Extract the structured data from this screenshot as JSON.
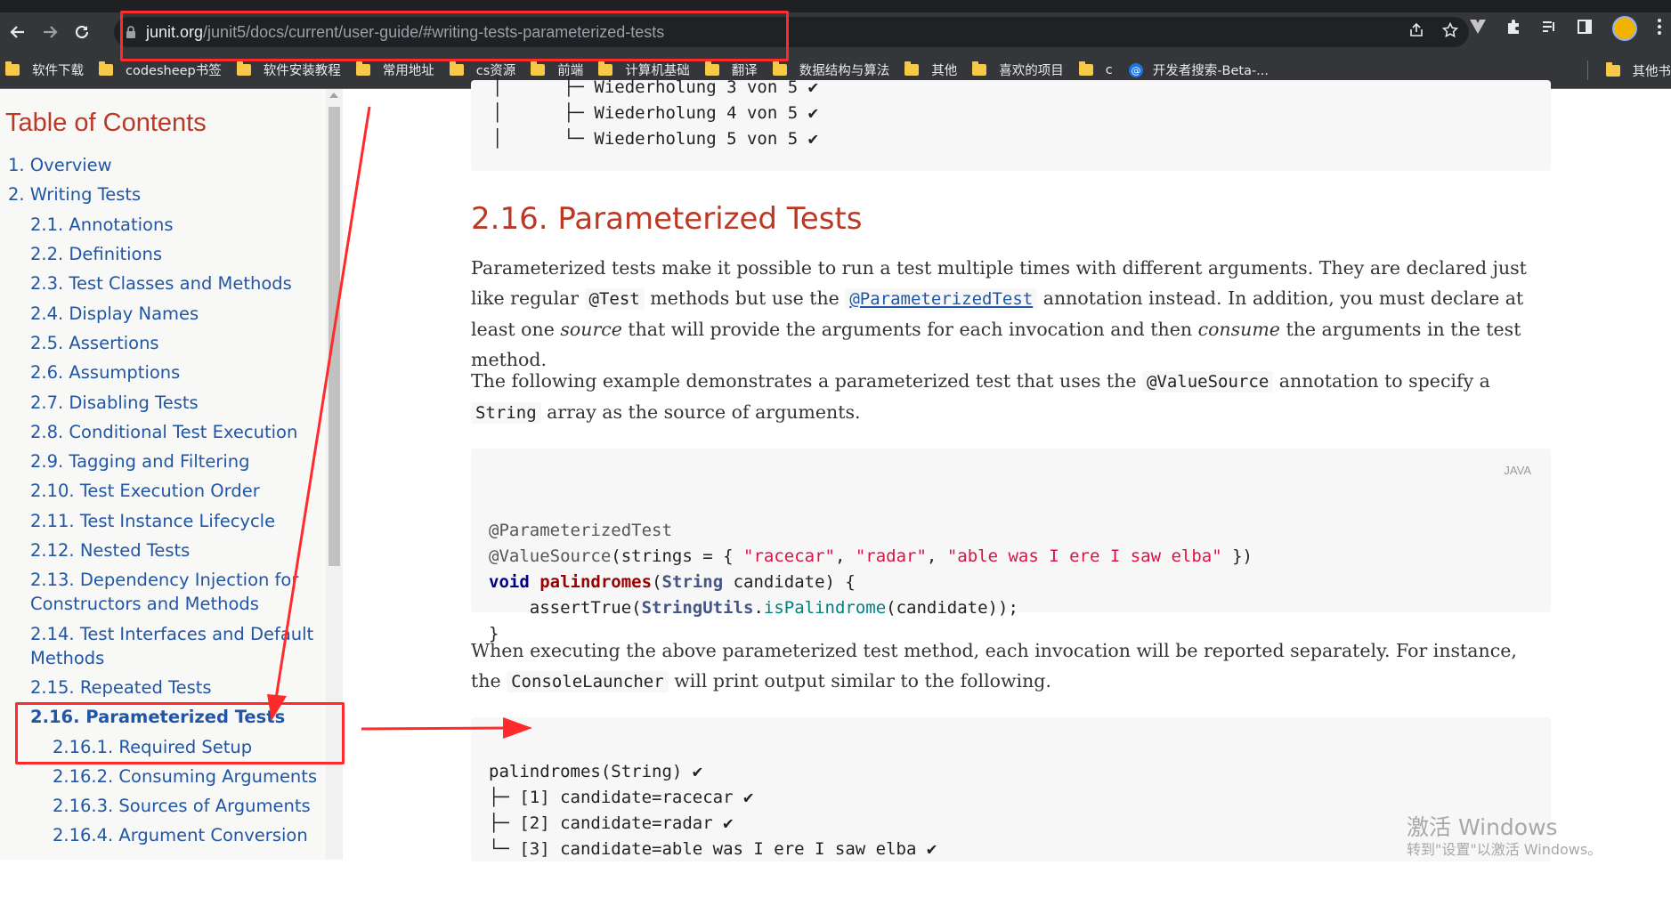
{
  "browser": {
    "url_domain": "junit.org",
    "url_path": "/junit5/docs/current/user-guide/#writing-tests-parameterized-tests",
    "bookmarks": [
      "软件下载",
      "codesheep书签",
      "软件安装教程",
      "常用地址",
      "cs资源",
      "前端",
      "计算机基础",
      "翻译",
      "数据结构与算法",
      "其他",
      "喜欢的项目",
      "c",
      "开发者搜索-Beta-..."
    ],
    "other_bookmarks": "其他书"
  },
  "toc": {
    "title": "Table of Contents",
    "items": [
      "1. Overview",
      "2. Writing Tests",
      "2.1. Annotations",
      "2.2. Definitions",
      "2.3. Test Classes and Methods",
      "2.4. Display Names",
      "2.5. Assertions",
      "2.6. Assumptions",
      "2.7. Disabling Tests",
      "2.8. Conditional Test Execution",
      "2.9. Tagging and Filtering",
      "2.10. Test Execution Order",
      "2.11. Test Instance Lifecycle",
      "2.12. Nested Tests",
      "2.13. Dependency Injection for",
      "Constructors and Methods",
      "2.14. Test Interfaces and Default",
      "Methods",
      "2.15. Repeated Tests",
      "2.16. Parameterized Tests",
      "2.16.1. Required Setup",
      "2.16.2. Consuming Arguments",
      "2.16.3. Sources of Arguments",
      "2.16.4. Argument Conversion"
    ]
  },
  "content": {
    "top_listing": [
      "│      ├─ Wiederholung 3 von 5 ✔",
      "│      ├─ Wiederholung 4 von 5 ✔",
      "│      └─ Wiederholung 5 von 5 ✔"
    ],
    "section_title": "2.16. Parameterized Tests",
    "p1": {
      "a": "Parameterized tests make it possible to run a test multiple times with different arguments. They are declared just like regular ",
      "code1": "@Test",
      "b": " methods but use the ",
      "link": "@ParameterizedTest",
      "c": " annotation instead. In addition, you must declare at least one ",
      "em1": "source",
      "d": " that will provide the arguments for each invocation and then ",
      "em2": "consume",
      "e": " the arguments in the test method."
    },
    "p2": {
      "a": "The following example demonstrates a parameterized test that uses the ",
      "code1": "@ValueSource",
      "b": " annotation to specify a ",
      "code2": "String",
      "c": " array as the source of arguments."
    },
    "code_lang": "JAVA",
    "code": {
      "l1": "@ParameterizedTest",
      "l2_ann": "@ValueSource",
      "l2_a": "(strings = { ",
      "l2_s1": "\"racecar\"",
      "l2_c1": ", ",
      "l2_s2": "\"radar\"",
      "l2_c2": ", ",
      "l2_s3": "\"able was I ere I saw elba\"",
      "l2_end": " })",
      "l3_kw": "void",
      "l3_fn": "palindromes",
      "l3_p1": "(",
      "l3_cls": "String",
      "l3_p2": " candidate) {",
      "l4_a": "    assertTrue(",
      "l4_cls": "StringUtils",
      "l4_dot": ".",
      "l4_meth": "isPalindrome",
      "l4_end": "(candidate));",
      "l5": "}"
    },
    "p3": {
      "a": "When executing the above parameterized test method, each invocation will be reported separately. For instance, the ",
      "code1": "ConsoleLauncher",
      "b": " will print output similar to the following."
    },
    "output": [
      "palindromes(String) ✔",
      "├─ [1] candidate=racecar ✔",
      "├─ [2] candidate=radar ✔",
      "└─ [3] candidate=able was I ere I saw elba ✔"
    ]
  },
  "watermark": {
    "line1": "激活 Windows",
    "line2": "转到\"设置\"以激活 Windows。"
  }
}
